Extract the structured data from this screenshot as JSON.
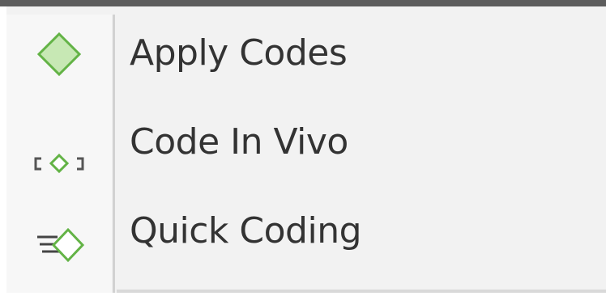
{
  "menu": {
    "accent_color": "#7cc25a",
    "items": [
      {
        "label": "Apply Codes",
        "icon": "diamond-code-icon"
      },
      {
        "label": "Code In Vivo",
        "icon": "in-vivo-code-icon"
      },
      {
        "label": "Quick Coding",
        "icon": "quick-coding-icon"
      }
    ]
  }
}
